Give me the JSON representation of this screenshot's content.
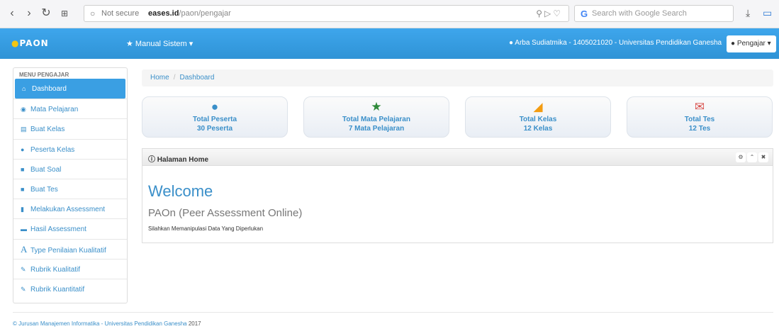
{
  "browser": {
    "not_secure": "Not secure",
    "domain": "eases.id",
    "path": "/paon/pengajar",
    "search_placeholder": "Search with Google Search"
  },
  "navbar": {
    "brand": "PAON",
    "manual_label": "Manual Sistem",
    "user_info": "Arba Sudiatmika - 1405021020 - Universitas Pendidikan Ganesha",
    "role_label": "Pengajar"
  },
  "sidebar": {
    "header": "MENU PENGAJAR",
    "items": [
      {
        "label": "Dashboard",
        "icon": "home-icon"
      },
      {
        "label": "Mata Pelajaran",
        "icon": "eye-icon"
      },
      {
        "label": "Buat Kelas",
        "icon": "list-icon"
      },
      {
        "label": "Peserta Kelas",
        "icon": "user-icon"
      },
      {
        "label": "Buat Soal",
        "icon": "book-icon"
      },
      {
        "label": "Buat Tes",
        "icon": "book-icon"
      },
      {
        "label": "Melakukan Assessment",
        "icon": "folder-open-icon"
      },
      {
        "label": "Hasil Assessment",
        "icon": "folder-icon"
      },
      {
        "label": "Type Penilaian Kualitatif",
        "icon": "font-icon"
      },
      {
        "label": "Rubrik Kualitatif",
        "icon": "pencil-icon"
      },
      {
        "label": "Rubrik Kuantitatif",
        "icon": "pencil-icon"
      }
    ]
  },
  "breadcrumb": {
    "home": "Home",
    "current": "Dashboard"
  },
  "cards": [
    {
      "title": "Total Peserta",
      "value": "30 Peserta",
      "icon": "user-icon",
      "color": "#3a8fc9"
    },
    {
      "title": "Total Mata Pelajaran",
      "value": "7 Mata Pelajaran",
      "icon": "star-icon",
      "color": "#2f8a3a"
    },
    {
      "title": "Total Kelas",
      "value": "12 Kelas",
      "icon": "cart-icon",
      "color": "#f39c12"
    },
    {
      "title": "Total Tes",
      "value": "12 Tes",
      "icon": "envelope-icon",
      "color": "#d9534f"
    }
  ],
  "panel": {
    "title": "Halaman Home",
    "welcome": "Welcome",
    "subtitle": "PAOn (Peer Assessment Online)",
    "description": "Silahkan Memanipulasi Data Yang Diperlukan"
  },
  "footer": {
    "link": "Jurusan Manajemen Informatika - Universitas Pendidikan Ganesha",
    "year": "2017"
  }
}
